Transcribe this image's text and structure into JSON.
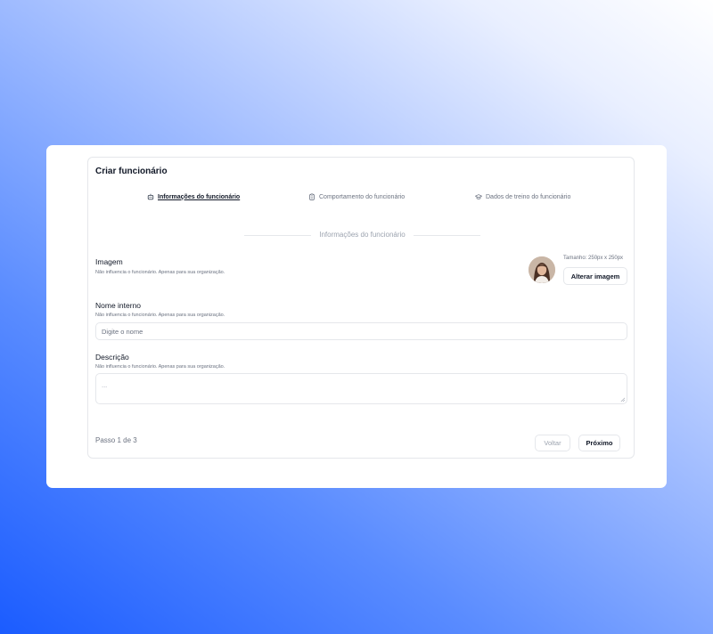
{
  "page": {
    "title": "Criar funcionário"
  },
  "tabs": [
    {
      "label": "Informações do funcionário",
      "icon": "robot-icon",
      "active": true
    },
    {
      "label": "Comportamento do funcionário",
      "icon": "clipboard-icon",
      "active": false
    },
    {
      "label": "Dados de treino do funcionário",
      "icon": "graduation-cap-icon",
      "active": false
    }
  ],
  "section": {
    "divider_label": "Informações do funcionário"
  },
  "image_field": {
    "label": "Imagem",
    "hint": "Não influencia o funcionário. Apenas para sua organização.",
    "size_note": "Tamanho: 250px x 250px",
    "change_button": "Alterar imagem"
  },
  "name_field": {
    "label": "Nome interno",
    "hint": "Não influencia o funcionário. Apenas para sua organização.",
    "placeholder": "Digite o nome",
    "value": ""
  },
  "description_field": {
    "label": "Descrição",
    "hint": "Não influencia o funcionário. Apenas para sua organização.",
    "placeholder": "...",
    "value": ""
  },
  "footer": {
    "step_text": "Passo 1 de 3",
    "back_label": "Voltar",
    "next_label": "Próximo"
  }
}
